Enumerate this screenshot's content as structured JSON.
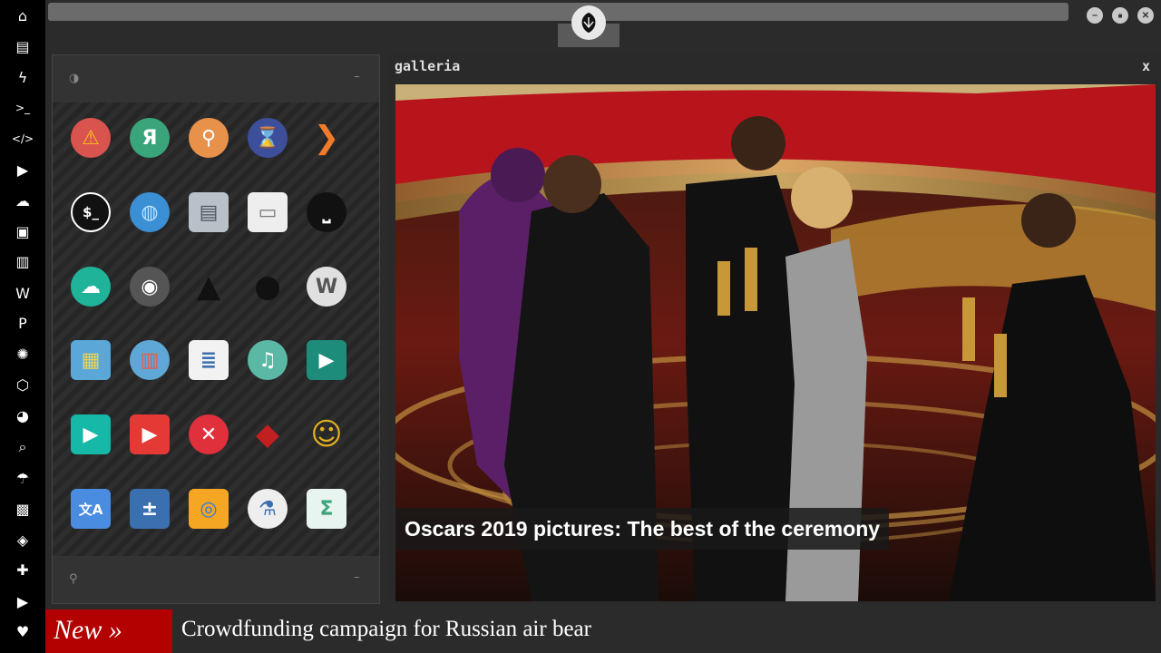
{
  "dock": {
    "items": [
      {
        "name": "home-icon",
        "glyph": "⌂"
      },
      {
        "name": "document-icon",
        "glyph": "▤"
      },
      {
        "name": "lightning-icon",
        "glyph": "ϟ"
      },
      {
        "name": "terminal-icon",
        "glyph": ">_"
      },
      {
        "name": "code-icon",
        "glyph": "</>"
      },
      {
        "name": "play-icon",
        "glyph": "▶"
      },
      {
        "name": "cloud-icon",
        "glyph": "☁"
      },
      {
        "name": "image-icon",
        "glyph": "▣"
      },
      {
        "name": "newspaper-icon",
        "glyph": "▥"
      },
      {
        "name": "wordpress-icon",
        "glyph": "W"
      },
      {
        "name": "pinterest-icon",
        "glyph": "P"
      },
      {
        "name": "aperture-icon",
        "glyph": "✺"
      },
      {
        "name": "network-icon",
        "glyph": "⬡"
      },
      {
        "name": "globe-icon",
        "glyph": "◕"
      },
      {
        "name": "search-icon",
        "glyph": "⌕"
      },
      {
        "name": "umbrella-icon",
        "glyph": "☂"
      },
      {
        "name": "contact-card-icon",
        "glyph": "▩"
      },
      {
        "name": "git-icon",
        "glyph": "◈"
      },
      {
        "name": "expand-icon",
        "glyph": "✚"
      },
      {
        "name": "youtube-icon",
        "glyph": "▶"
      },
      {
        "name": "heart-icon",
        "glyph": "♥"
      }
    ]
  },
  "window_controls": {
    "minimize": "–",
    "maximize": "■",
    "close": "✕"
  },
  "launcher": {
    "header_icon": "◑",
    "header_collapse": "–",
    "footer_icon": "⚲",
    "footer_collapse": "–",
    "apps": [
      {
        "name": "warning-app-icon",
        "glyph": "⚠",
        "bg": "#d9534f",
        "fg": "#f5c518"
      },
      {
        "name": "yandex-app-icon",
        "glyph": "Я",
        "bg": "#3aa57a",
        "fg": "#ffffff"
      },
      {
        "name": "search-app-icon",
        "glyph": "⚲",
        "bg": "#e8914a",
        "fg": "#ffffff"
      },
      {
        "name": "hourglass-app-icon",
        "glyph": "⌛",
        "bg": "#3d4f9a",
        "fg": "#f0c060"
      },
      {
        "name": "arrow-app-icon",
        "glyph": "❯",
        "bg": "transparent",
        "fg": "#f07b2a"
      },
      {
        "name": "terminal-app-icon",
        "glyph": "$_",
        "bg": "#111111",
        "fg": "#ffffff"
      },
      {
        "name": "globe-app-icon",
        "glyph": "◍",
        "bg": "#3b8fd4",
        "fg": "#bfe3ff"
      },
      {
        "name": "scanner-app-icon",
        "glyph": "▤",
        "bg": "#b8c0c8",
        "fg": "#4a5560"
      },
      {
        "name": "window-app-icon",
        "glyph": "▭",
        "bg": "#eeeeee",
        "fg": "#777777"
      },
      {
        "name": "spacebar-app-icon",
        "glyph": "⎵",
        "bg": "#111111",
        "fg": "#ffffff"
      },
      {
        "name": "cloud-lock-app-icon",
        "glyph": "☁",
        "bg": "#1fb39a",
        "fg": "#ffffff"
      },
      {
        "name": "github-app-icon",
        "glyph": "◉",
        "bg": "#555555",
        "fg": "#ffffff"
      },
      {
        "name": "starfleet-app-icon",
        "glyph": "▲",
        "bg": "transparent",
        "fg": "#111111"
      },
      {
        "name": "death-star-app-icon",
        "glyph": "●",
        "bg": "transparent",
        "fg": "#111111"
      },
      {
        "name": "wikipedia-app-icon",
        "glyph": "W",
        "bg": "#e0e0e0",
        "fg": "#555555"
      },
      {
        "name": "map-app-icon",
        "glyph": "▦",
        "bg": "#5ba8d8",
        "fg": "#e8d35a"
      },
      {
        "name": "books-app-icon",
        "glyph": "▥",
        "bg": "#5fa7d6",
        "fg": "#e85a4a"
      },
      {
        "name": "notes-app-icon",
        "glyph": "≣",
        "bg": "#f2f2f2",
        "fg": "#3a6fb0"
      },
      {
        "name": "music-app-icon",
        "glyph": "♫",
        "bg": "#5bb8a4",
        "fg": "#ffffff"
      },
      {
        "name": "video-app-icon",
        "glyph": "▶",
        "bg": "#1e8c7a",
        "fg": "#ffffff"
      },
      {
        "name": "media-player-app-icon",
        "glyph": "▶",
        "bg": "#16b8a8",
        "fg": "#ffffff"
      },
      {
        "name": "youtube-app-icon",
        "glyph": "▶",
        "bg": "#e53935",
        "fg": "#ffffff"
      },
      {
        "name": "close-app-icon",
        "glyph": "✕",
        "bg": "#e0303c",
        "fg": "#ffffff"
      },
      {
        "name": "iron-man-app-icon",
        "glyph": "◆",
        "bg": "transparent",
        "fg": "#c02020"
      },
      {
        "name": "c3po-app-icon",
        "glyph": "☺",
        "bg": "transparent",
        "fg": "#e0b020"
      },
      {
        "name": "translate-app-icon",
        "glyph": "文A",
        "bg": "#4a8de0",
        "fg": "#ffffff"
      },
      {
        "name": "calculator-app-icon",
        "glyph": "±",
        "bg": "#3a6fb0",
        "fg": "#ffffff"
      },
      {
        "name": "chrome-app-icon",
        "glyph": "◎",
        "bg": "#f5a623",
        "fg": "#2f7bd8"
      },
      {
        "name": "flask-app-icon",
        "glyph": "⚗",
        "bg": "#eeeeee",
        "fg": "#3a6fb0"
      },
      {
        "name": "sigma-app-icon",
        "glyph": "Σ",
        "bg": "#e8f4f0",
        "fg": "#3aa57a"
      }
    ]
  },
  "gallery": {
    "title": "galleria",
    "close": "x",
    "caption": "Oscars 2019 pictures: The best of the ceremony"
  },
  "ticker": {
    "tag": "New »",
    "headline": "Crowdfunding campaign for Russian air bear"
  }
}
